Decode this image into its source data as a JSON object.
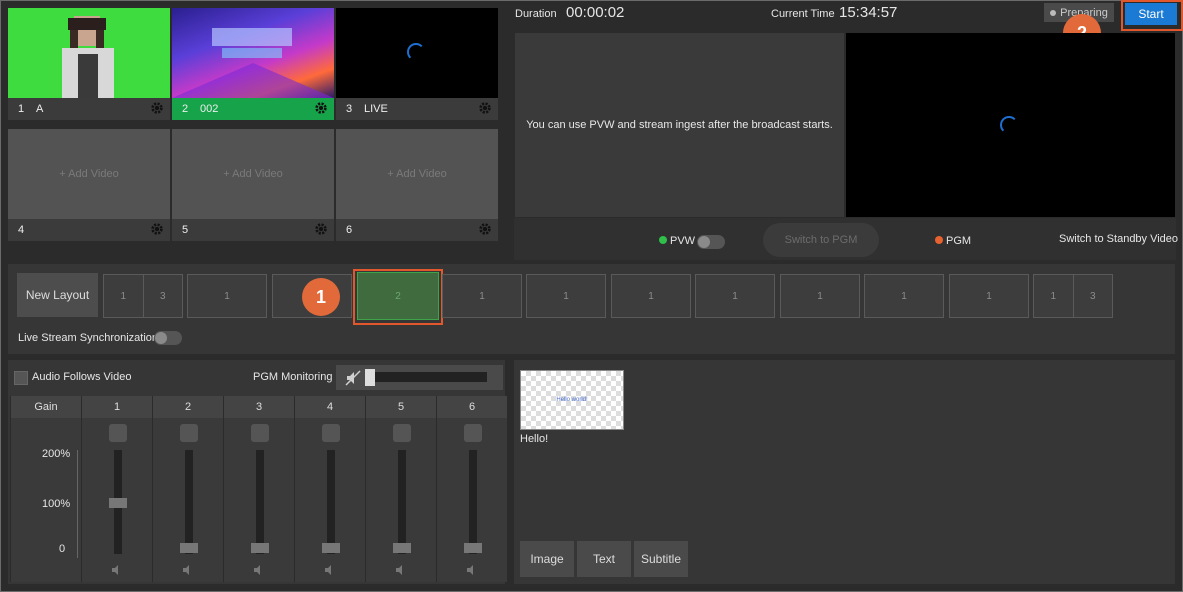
{
  "sources": [
    {
      "num": "1",
      "label": "A"
    },
    {
      "num": "2",
      "label": "002"
    },
    {
      "num": "3",
      "label": "LIVE"
    },
    {
      "num": "4",
      "label": ""
    },
    {
      "num": "5",
      "label": ""
    },
    {
      "num": "6",
      "label": ""
    }
  ],
  "add_video_label": "+ Add Video",
  "header": {
    "duration_label": "Duration",
    "duration_value": "00:00:02",
    "current_time_label": "Current Time",
    "current_time_value": "15:34:57",
    "status": "Preparing",
    "start_label": "Start"
  },
  "preview": {
    "message": "You can use PVW and stream ingest after the broadcast starts.",
    "pvw_label": "PVW",
    "switch_pgm_label": "Switch to PGM",
    "pgm_label": "PGM",
    "standby_label": "Switch to Standby Video"
  },
  "layouts": {
    "new_layout_label": "New Layout",
    "cells": [
      [
        "1",
        "3"
      ],
      [
        "1"
      ],
      [
        "1"
      ],
      [
        "2"
      ],
      [
        "1"
      ],
      [
        "1"
      ],
      [
        "1"
      ],
      [
        "1"
      ],
      [
        "1"
      ],
      [
        "1"
      ],
      [
        "1"
      ],
      [
        "1",
        "3"
      ]
    ],
    "sync_label": "Live Stream Synchronization"
  },
  "audio": {
    "follows_label": "Audio Follows Video",
    "monitoring_label": "PGM Monitoring",
    "gain_label": "Gain",
    "channels": [
      "1",
      "2",
      "3",
      "4",
      "5",
      "6"
    ],
    "scale": [
      "200%",
      "100%",
      "0"
    ]
  },
  "overlay": {
    "thumb_text": "Hello world!",
    "item_label": "Hello!",
    "buttons": [
      "Image",
      "Text",
      "Subtitle"
    ]
  },
  "callouts": [
    "1",
    "2"
  ],
  "colors": {
    "accent": "#1a7ad4",
    "active_green": "#16a34a",
    "callout": "#e26a3a",
    "pgm_dot": "#e8622f",
    "pvw_dot": "#2fbf4a"
  }
}
